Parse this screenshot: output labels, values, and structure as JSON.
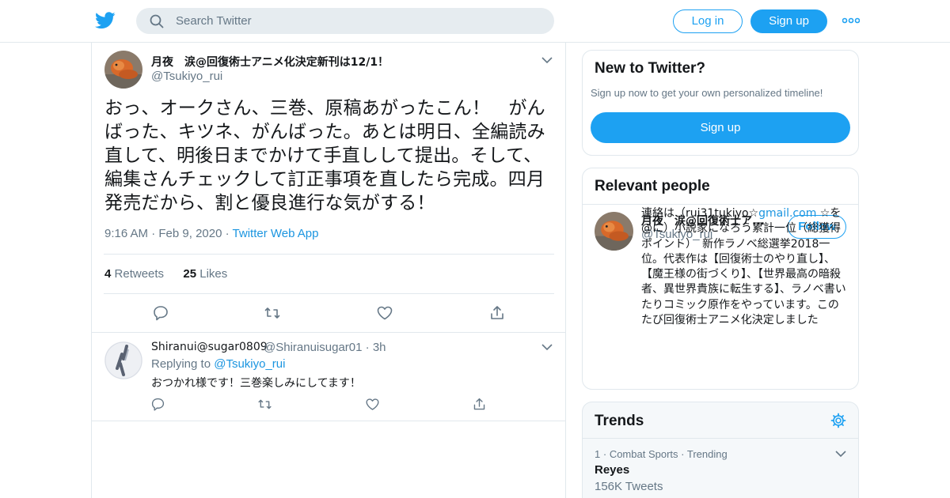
{
  "header": {
    "search_placeholder": "Search Twitter",
    "login_label": "Log in",
    "signup_label": "Sign up"
  },
  "tweet": {
    "author_name": "月夜　涙@回復術士アニメ化決定新刊は12/1！",
    "author_handle": "@Tsukiyo_rui",
    "text": "おっ、オークさん、三巻、原稿あがったこん！　がんばった、キツネ、がんばった。あとは明日、全編読み直して、明後日までかけて手直しして提出。そして、編集さんチェックして訂正事項を直したら完成。四月発売だから、割と優良進行な気がする！",
    "time": "9:16 AM",
    "date": "Feb 9, 2020",
    "source": "Twitter Web App",
    "retweets_count": "4",
    "retweets_label": "Retweets",
    "likes_count": "25",
    "likes_label": "Likes"
  },
  "reply": {
    "author_name": "Shiranui@sugar0809",
    "author_handle": "@Shiranuisugar01",
    "time": "3h",
    "replying_prefix": "Replying to",
    "replying_to": "@Tsukiyo_rui",
    "text": "おつかれ様です！三巻楽しみにしてます！"
  },
  "sidebar": {
    "new_to_twitter": {
      "title": "New to Twitter?",
      "subtitle": "Sign up now to get your own personalized timeline!",
      "signup_label": "Sign up"
    },
    "relevant_people": {
      "title": "Relevant people",
      "name": "月夜　涙@回復術士ア...",
      "handle": "@Tsukiyo_rui",
      "follow_label": "Follow",
      "bio_prefix": "連絡は（rui31tukiyo☆",
      "bio_link": "gmail.com",
      "bio_rest": " ☆を@に）小説家になろう累計一位（総獲得ポイント）　新作ラノベ総選挙2018一位。代表作は【回復術士のやり直し】、【魔王様の街づくり】、【世界最高の暗殺者、異世界貴族に転生する】、ラノベ書いたりコミック原作をやっています。このたび回復術士アニメ化決定しました"
    },
    "trends": {
      "title": "Trends",
      "items": [
        {
          "rank": "1",
          "category": "Combat Sports",
          "status": "Trending",
          "name": "Reyes",
          "count": "156K Tweets"
        }
      ]
    }
  },
  "colors": {
    "accent": "#1da1f2",
    "link": "#1b95e0",
    "muted": "#657786",
    "border": "#e1e8ed"
  }
}
